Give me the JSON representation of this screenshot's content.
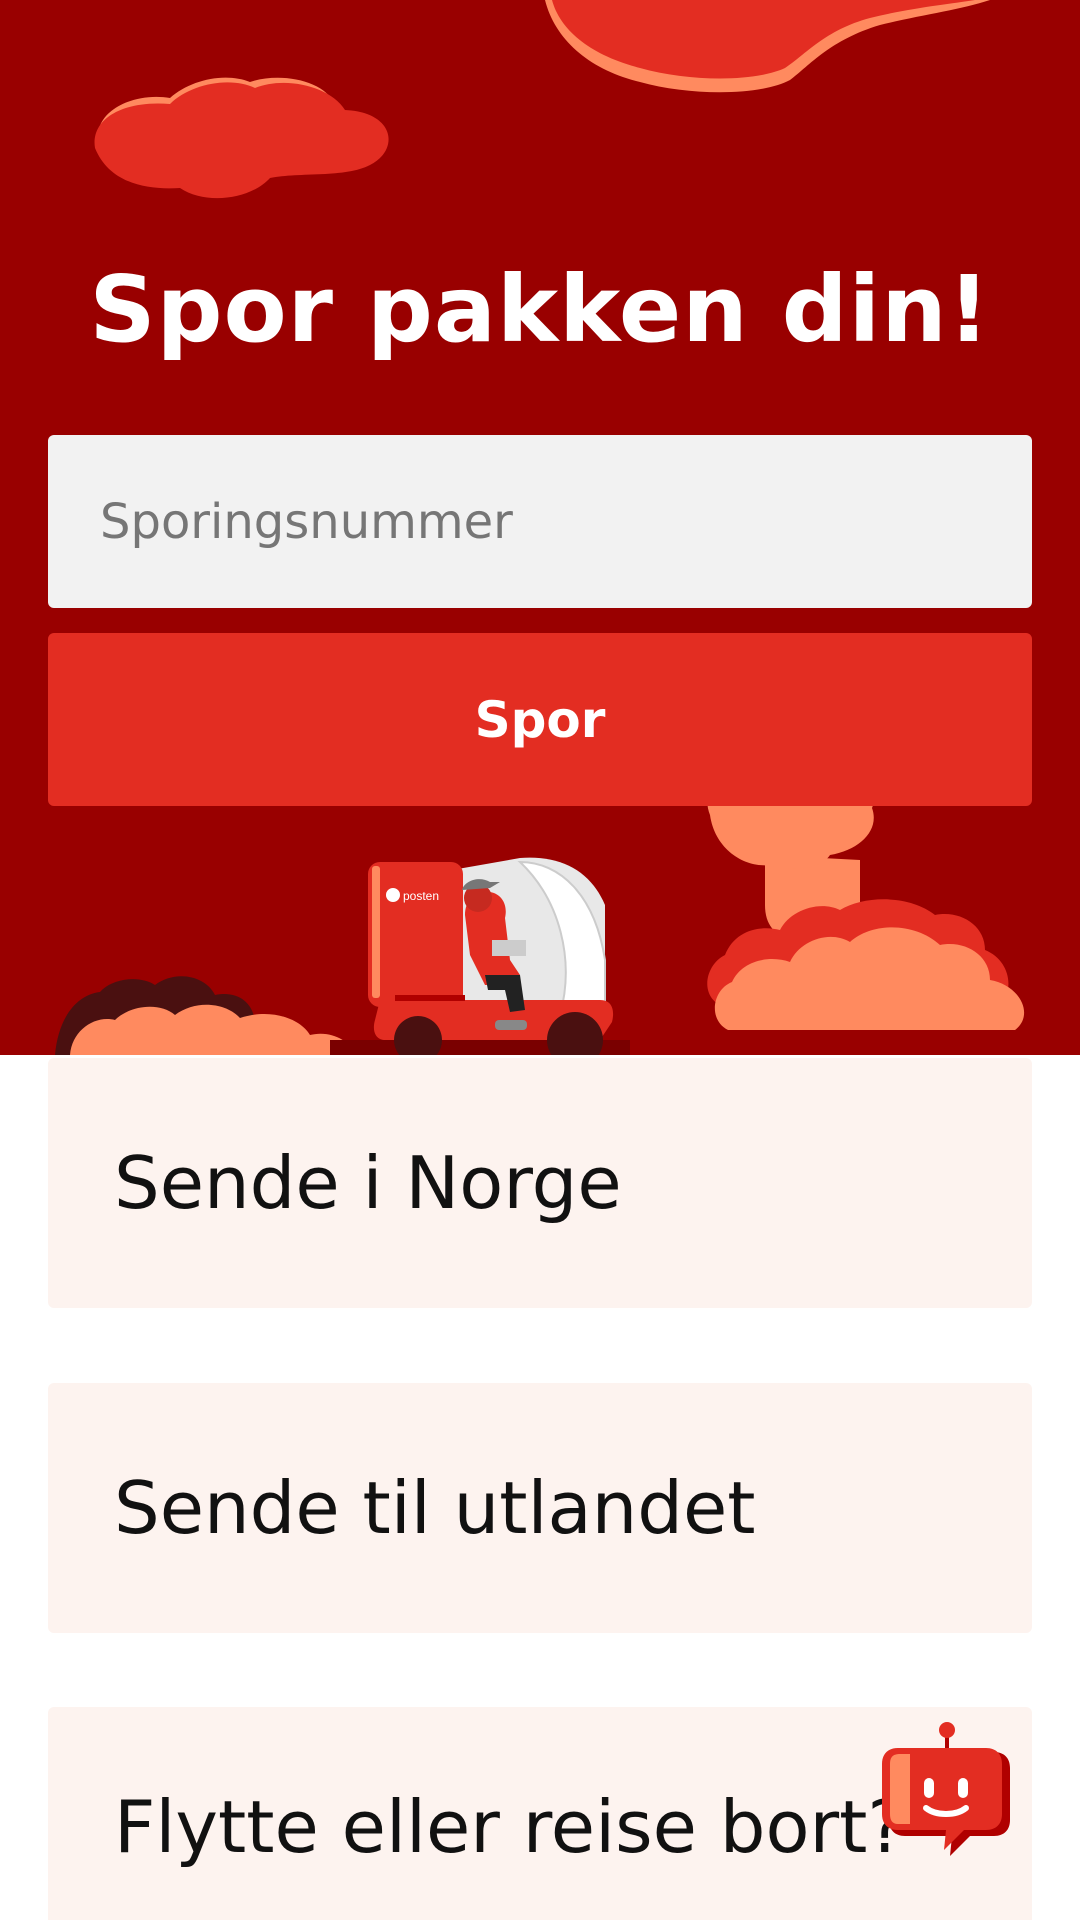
{
  "hero": {
    "title": "Spor pakken din!",
    "scooter_logo_text": "posten"
  },
  "tracking": {
    "placeholder": "Sporingsnummer",
    "button_label": "Spor"
  },
  "cards": [
    {
      "label": "Sende i Norge"
    },
    {
      "label": "Sende til utlandet"
    },
    {
      "label": "Flytte eller reise bort?"
    }
  ],
  "icons": {
    "chat": "chat-bot-icon"
  },
  "colors": {
    "hero_background": "#990000",
    "accent_red": "#e32d22",
    "cloud_peach": "#ff8a5f",
    "card_background": "#fdf3ef",
    "input_background": "#f2f2f2"
  }
}
